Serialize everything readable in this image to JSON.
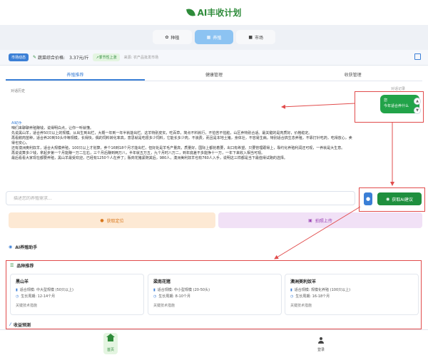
{
  "header": {
    "title": "AI丰收计划"
  },
  "tabs": [
    {
      "label": "种植",
      "icon": "sprout-icon"
    },
    {
      "label": "养殖",
      "icon": "barn-icon"
    },
    {
      "label": "市场",
      "icon": "shop-icon"
    }
  ],
  "price_bar": {
    "badge": "市场动态",
    "label": "蔬菜综合价格:",
    "value": "3.37元/斤",
    "trend": "↗季节性上涨",
    "source": "来源: 农产品批发市场"
  },
  "subtabs": [
    "养殖推荐",
    "健康管理",
    "收获管理"
  ],
  "chat": {
    "history_label": "对话历史",
    "right_label": "对话记录",
    "bubble_line1": "您",
    "bubble_line2": "今年适合养什么",
    "assistant_label": "AI助手",
    "lines": [
      "咱们来聊聊养殖赚钱，说得明白点，让你一听就懂。",
      "先说黑山羊，适合养50只以上的规模。从出生到出栏，大概一年到一年半就能出栏。这羊特别皮实，吃百草，简点不料就行，不怕苦不怕脏，山区养特别合适。最关键的是肉质好，价格稳定。",
      "再看鹅肉苗种，适合养20到50头中等规模，长得快，偶的饲料转化率高，意思就是吃很多少饲料，它能长多少肉，不浪费，而且是本地土猪，身体壮，不容易生病，特别适合搞生态养殖，不靠打针吃药，吃得放心，卖得也安心。",
      "还有澳洲奥利奴羊，适合大规模养殖，100只以上才划算，养个16到18个月才能出栏，但好处是羊毛产量高，质量好，国际上都抢着要，出口有希望。只要管理跟得上，靠约化养殖利润还可观，一养就是大生意。",
      "再说说算多少钱，拿起步第一个月能赚一万二左右，三个月后赚到两万八，半年就五万五，九个月时八万二，到年底差不多能挣十一万，一年下来收入相当可观。",
      "最后看看大家现在都要养殖，黑山羊最受欢迎，已经有1250个人在养了；贩商花猪紧随其后，980人，澳洲美利奴羊也有760人入手，说明这三样都是当下最值得试跑的选择。"
    ]
  },
  "input": {
    "placeholder": "描述您的养殖需求..."
  },
  "buttons": {
    "ai": "获取AI建议",
    "location": "获取定位",
    "photo": "拍照上传"
  },
  "assistant_title": "AI养殖助手",
  "varieties": {
    "title": "品种推荐",
    "cards": [
      {
        "name": "黑山羊",
        "scale": "适合规模: 中大型规模 (50只以上)",
        "cycle": "生长周期: 12-14个月",
        "tech": "关键技术措施"
      },
      {
        "name": "梁南花猪",
        "scale": "适合规模: 中小型规模 (20-50头)",
        "cycle": "生长周期: 8-10个月",
        "tech": "关键技术措施"
      },
      {
        "name": "澳洲美利奴羊",
        "scale": "适合规模: 规模化养殖 (100只以上)",
        "cycle": "生长周期: 16-18个月",
        "tech": "关键技术措施"
      }
    ]
  },
  "profit_title": "收益预测",
  "bottom_nav": {
    "home": "首页",
    "login": "登录"
  },
  "colors": {
    "brand": "#2e8b3a",
    "accent": "#3b7fd6",
    "annotation": "#e14c4c"
  }
}
